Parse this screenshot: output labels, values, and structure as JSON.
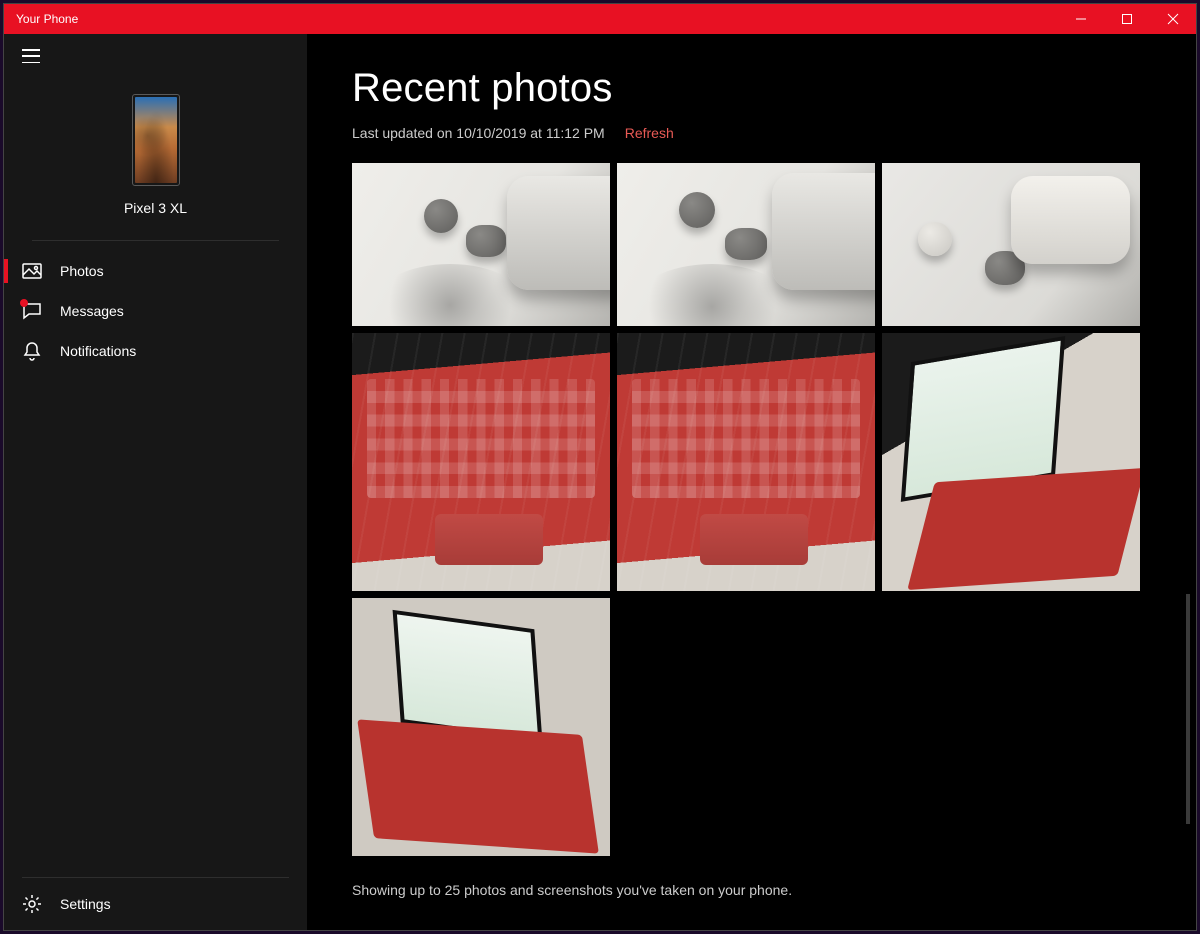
{
  "titlebar": {
    "title": "Your Phone"
  },
  "device": {
    "name": "Pixel 3 XL"
  },
  "nav": {
    "items": [
      {
        "label": "Photos",
        "icon": "photos",
        "selected": true,
        "badge": false
      },
      {
        "label": "Messages",
        "icon": "messages",
        "selected": false,
        "badge": true
      },
      {
        "label": "Notifications",
        "icon": "notifications",
        "selected": false,
        "badge": false
      }
    ],
    "settings_label": "Settings"
  },
  "main": {
    "title": "Recent photos",
    "last_updated": "Last updated on 10/10/2019 at 11:12 PM",
    "refresh_label": "Refresh",
    "footer": "Showing up to 25 photos and screenshots you've taken on your phone.",
    "photos": [
      {
        "desc": "earbuds-and-case-1",
        "row": 1
      },
      {
        "desc": "earbuds-and-case-2",
        "row": 1
      },
      {
        "desc": "earbuds-and-case-3",
        "row": 1
      },
      {
        "desc": "red-keyboard-topdown-1",
        "row": 2
      },
      {
        "desc": "red-keyboard-topdown-2",
        "row": 2
      },
      {
        "desc": "laptop-angled-red-1",
        "row": 2
      },
      {
        "desc": "laptop-angled-red-2",
        "row": 3
      }
    ]
  },
  "colors": {
    "accent": "#e81123"
  }
}
